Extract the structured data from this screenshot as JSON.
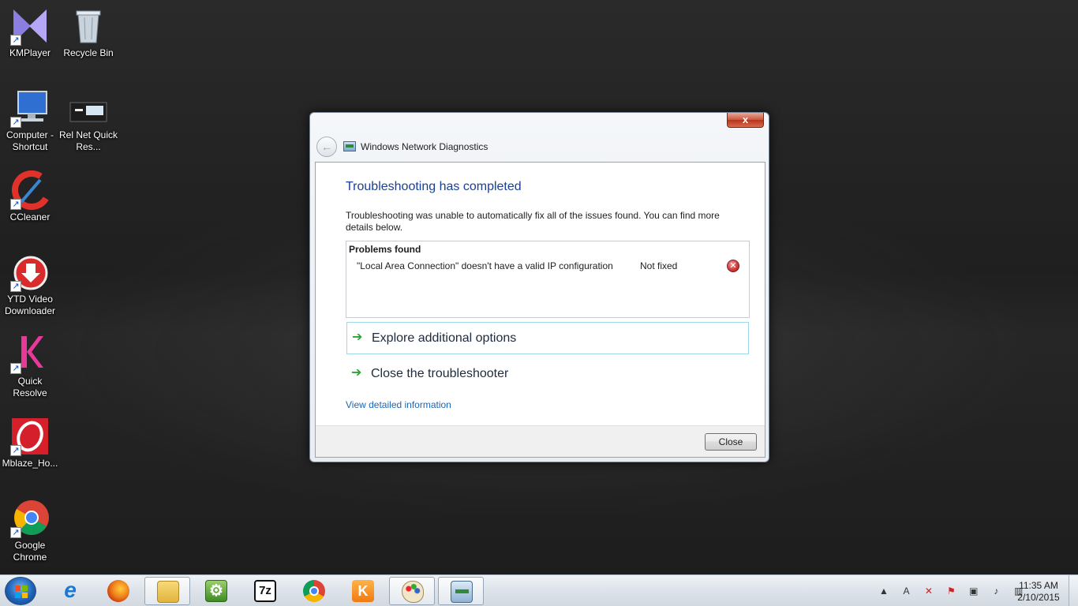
{
  "desktop": {
    "icons": [
      {
        "label": "KMPlayer"
      },
      {
        "label": "Recycle Bin"
      },
      {
        "label": "Computer - Shortcut"
      },
      {
        "label": "Rel Net Quick Res..."
      },
      {
        "label": "CCleaner"
      },
      {
        "label": "YTD Video Downloader"
      },
      {
        "label": "Quick Resolve"
      },
      {
        "label": "Mblaze_Ho..."
      },
      {
        "label": "Google Chrome"
      }
    ]
  },
  "dialog": {
    "close_glyph": "x",
    "back_glyph": "←",
    "title": "Windows Network Diagnostics",
    "heading": "Troubleshooting has completed",
    "description": "Troubleshooting was unable to automatically fix all of the issues found. You can find more details below.",
    "problems": {
      "header": "Problems found",
      "rows": [
        {
          "text": "\"Local Area Connection\" doesn't have a valid IP configuration",
          "status": "Not fixed",
          "icon": "error-icon"
        }
      ]
    },
    "options": [
      {
        "label": "Explore additional options"
      },
      {
        "label": "Close the troubleshooter"
      }
    ],
    "details_link": "View detailed information",
    "close_button": "Close"
  },
  "taskbar": {
    "items": [
      {
        "name": "internet-explorer",
        "glyph": "e"
      },
      {
        "name": "firefox",
        "glyph": ""
      },
      {
        "name": "windows-explorer",
        "glyph": ""
      },
      {
        "name": "settings-app",
        "glyph": ""
      },
      {
        "name": "7zip",
        "glyph": "7z"
      },
      {
        "name": "chrome",
        "glyph": ""
      },
      {
        "name": "kmplayer",
        "glyph": "K"
      },
      {
        "name": "paint",
        "glyph": ""
      },
      {
        "name": "network-diagnostics",
        "glyph": ""
      }
    ],
    "tray_glyphs": [
      "▲",
      "A",
      "✕",
      "⚑",
      "▣",
      "♪",
      "▥"
    ],
    "clock_time": "11:35 AM",
    "clock_date": "2/10/2015"
  },
  "colors": {
    "heading": "#1b3f91",
    "link": "#1a66b8",
    "arrow": "#2aa535",
    "error": "#d23c3c"
  }
}
